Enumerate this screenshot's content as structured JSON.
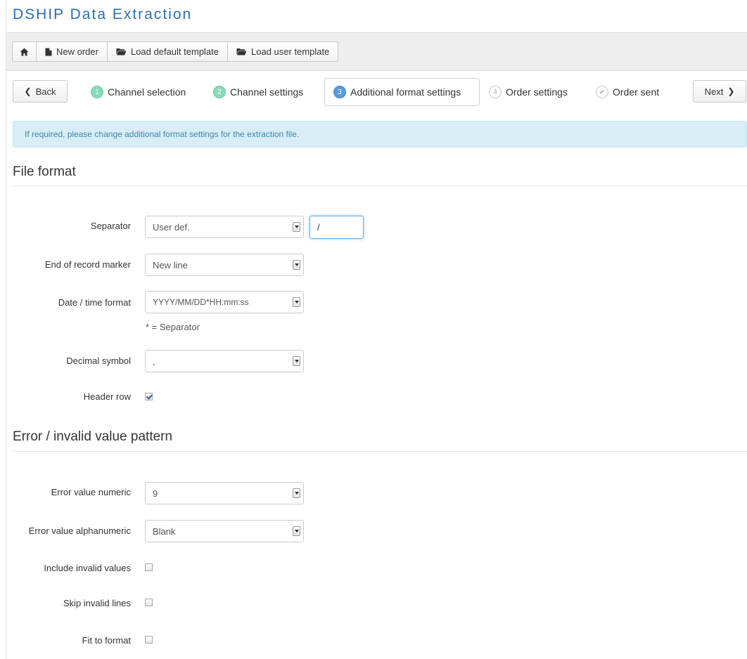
{
  "app": {
    "title": "DSHIP Data Extraction"
  },
  "toolbar": {
    "home_icon": "home-icon",
    "new_order_label": "New order",
    "new_order_icon": "file-icon",
    "load_default_label": "Load default template",
    "load_default_icon": "folder-open-icon",
    "load_user_label": "Load user template",
    "load_user_icon": "folder-open-icon"
  },
  "wizard": {
    "back_label": "Back",
    "next_label": "Next",
    "steps": [
      {
        "num": "1",
        "label": "Channel selection",
        "state": "done"
      },
      {
        "num": "2",
        "label": "Channel settings",
        "state": "done"
      },
      {
        "num": "3",
        "label": "Additional format settings",
        "state": "current"
      },
      {
        "num": "4",
        "label": "Order settings",
        "state": "pending"
      },
      {
        "num": "✔",
        "label": "Order sent",
        "state": "pending"
      }
    ]
  },
  "alert": {
    "text": "If required, please change additional format settings for the extraction file."
  },
  "file_format": {
    "title": "File format",
    "separator": {
      "label": "Separator",
      "value": "User def.",
      "custom_value": "/"
    },
    "end_of_record": {
      "label": "End of record marker",
      "value": "New line"
    },
    "date_time": {
      "label": "Date / time format",
      "value": "YYYY/MM/DD*HH:mm:ss",
      "hint": "* = Separator"
    },
    "decimal": {
      "label": "Decimal symbol",
      "value": ","
    },
    "header_row": {
      "label": "Header row",
      "checked": true
    }
  },
  "error_pattern": {
    "title": "Error / invalid value pattern",
    "numeric": {
      "label": "Error value numeric",
      "value": "9"
    },
    "alphanumeric": {
      "label": "Error value alphanumeric",
      "value": "Blank"
    },
    "include_invalid": {
      "label": "Include invalid values",
      "checked": false
    },
    "skip_invalid": {
      "label": "Skip invalid lines",
      "checked": false
    },
    "fit_to_format": {
      "label": "Fit to format",
      "checked": false
    }
  },
  "colors": {
    "title": "#2a6fb0",
    "alert_bg": "#d9edf7",
    "alert_text": "#3a87ad",
    "step_done": "#86dab8",
    "step_current": "#5b9bdc"
  }
}
